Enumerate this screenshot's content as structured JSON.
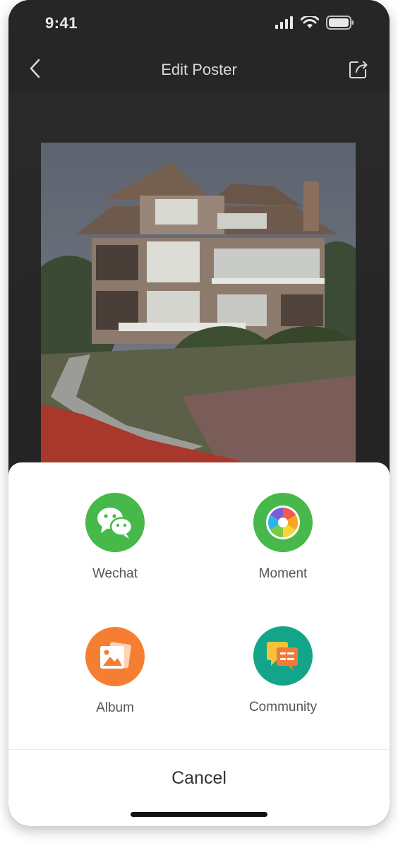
{
  "status_bar": {
    "time": "9:41",
    "icons": [
      "signal-icon",
      "wifi-icon",
      "battery-icon"
    ]
  },
  "nav": {
    "title": "Edit Poster",
    "back_icon": "chevron-left-icon",
    "share_icon": "share-icon"
  },
  "poster": {
    "image": "house-photo"
  },
  "share_sheet": {
    "options": [
      {
        "label": "Wechat",
        "icon": "wechat-icon",
        "color": "#46b94a"
      },
      {
        "label": "Moment",
        "icon": "moment-aperture-icon",
        "color": "#46b94a"
      },
      {
        "label": "Album",
        "icon": "album-icon",
        "color": "#f57e33"
      },
      {
        "label": "Community",
        "icon": "community-icon",
        "color": "#13a58a"
      }
    ],
    "cancel_label": "Cancel"
  },
  "colors": {
    "background_dark": "#262626",
    "sheet_background": "#ffffff",
    "label_text": "#555555"
  }
}
